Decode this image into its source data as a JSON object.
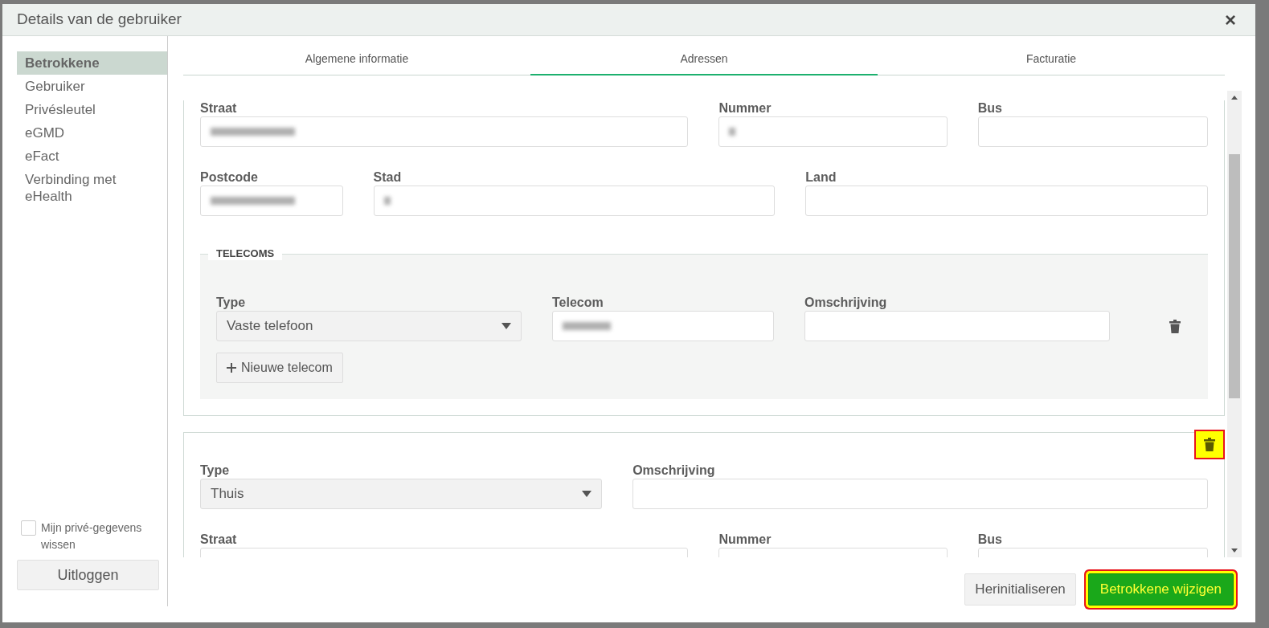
{
  "window": {
    "title": "Details van de gebruiker",
    "close": "×"
  },
  "sidebar": {
    "items": [
      {
        "label": "Betrokkene",
        "selected": true
      },
      {
        "label": "Gebruiker",
        "selected": false
      },
      {
        "label": "Privésleutel",
        "selected": false
      },
      {
        "label": "eGMD",
        "selected": false
      },
      {
        "label": "eFact",
        "selected": false
      },
      {
        "label": "Verbinding met eHealth",
        "selected": false
      }
    ],
    "wipe_checkbox": {
      "label": "Mijn privé-gegevens wissen",
      "checked": false
    },
    "logout_button": "Uitloggen"
  },
  "tabs": [
    {
      "label": "Algemene informatie",
      "selected": false
    },
    {
      "label": "Adressen",
      "selected": true
    },
    {
      "label": "Facturatie",
      "selected": false
    }
  ],
  "addresses": [
    {
      "rows": [
        [
          {
            "kind": "text",
            "label": "Straat",
            "redacted": true
          },
          {
            "kind": "text",
            "label": "Nummer",
            "redacted": true
          },
          {
            "kind": "text",
            "label": "Bus",
            "redacted": false
          }
        ],
        [
          {
            "kind": "text",
            "label": "Postcode",
            "redacted": true
          },
          {
            "kind": "text",
            "label": "Stad",
            "redacted": true
          },
          {
            "kind": "text",
            "label": "Land",
            "redacted": false
          }
        ]
      ],
      "telecoms": {
        "legend": "TELECOMS",
        "rows": [
          [
            {
              "kind": "select",
              "label": "Type",
              "value": "Vaste telefoon"
            },
            {
              "kind": "text",
              "label": "Telecom",
              "redacted": true
            },
            {
              "kind": "text",
              "label": "Omschrijving",
              "redacted": false
            }
          ]
        ],
        "add_button": "Nieuwe telecom"
      }
    },
    {
      "highlighted_delete": true,
      "rows": [
        [
          {
            "kind": "select",
            "label": "Type",
            "value": "Thuis"
          },
          {
            "kind": "text",
            "label": "Omschrijving",
            "redacted": false
          }
        ],
        [
          {
            "kind": "text",
            "label": "Straat"
          },
          {
            "kind": "text",
            "label": "Nummer"
          },
          {
            "kind": "text",
            "label": "Bus"
          }
        ]
      ]
    }
  ],
  "footer": {
    "reset_button": "Herinitialiseren",
    "submit_button": {
      "label": "Betrokkene wijzigen",
      "highlighted": true
    }
  }
}
